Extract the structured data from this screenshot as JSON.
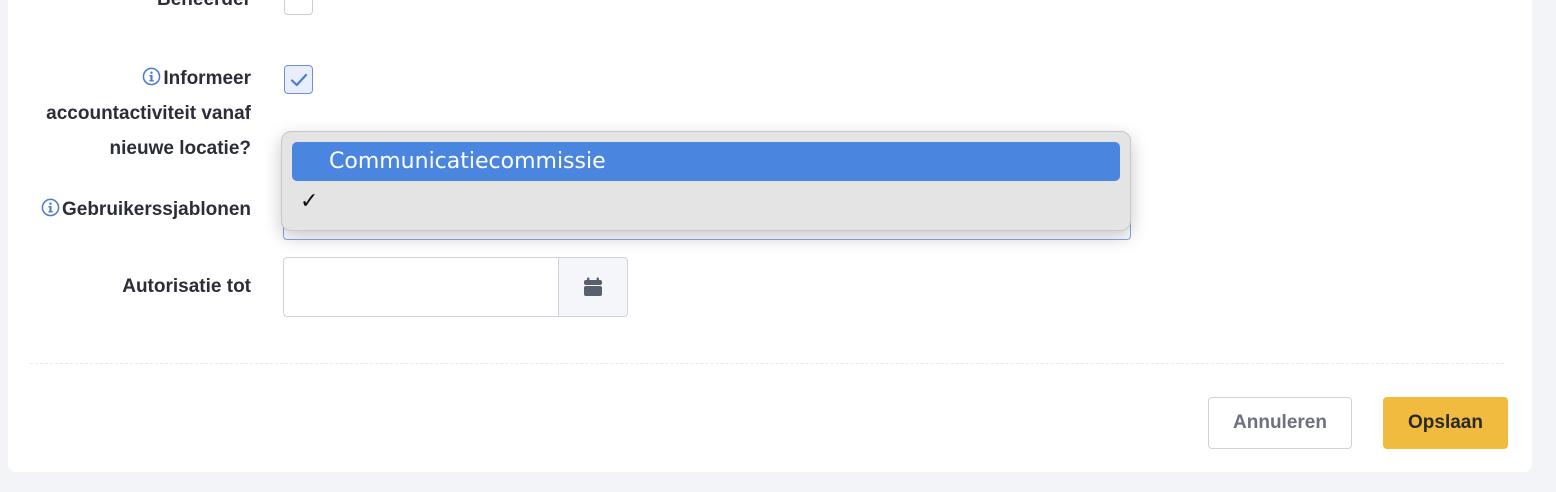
{
  "form": {
    "fields": {
      "beheerder": {
        "label": "Beheerder",
        "checked": false
      },
      "informeer": {
        "label_line1": "Informeer",
        "label_line2": "accountactiviteit vanaf",
        "label_line3": "nieuwe locatie?",
        "checked": true
      },
      "gebruikerssjablonen": {
        "label": "Gebruikerssjablonen",
        "value": ""
      },
      "autorisatie_tot": {
        "label": "Autorisatie tot",
        "value": ""
      }
    }
  },
  "dropdown": {
    "options": [
      {
        "label": "Communicatiecommissie",
        "highlighted": true
      },
      {
        "label": "",
        "checkmark": "✓"
      }
    ]
  },
  "actions": {
    "cancel_label": "Annuleren",
    "save_label": "Opslaan"
  },
  "colors": {
    "accent": "#4a86e0",
    "save_button": "#f0bb3e",
    "info_icon": "#4a7bd0"
  },
  "icons": [
    "info-icon",
    "check-icon",
    "calendar-icon"
  ]
}
